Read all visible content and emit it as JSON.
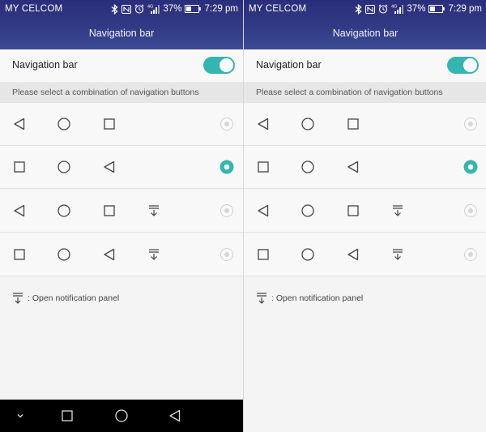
{
  "status_bar": {
    "carrier": "MY CELCOM",
    "battery": "37%",
    "time": "7:29 pm",
    "network_label": "4G",
    "icons": [
      "bluetooth-icon",
      "nfc-icon",
      "alarm-icon",
      "signal-icon",
      "battery-icon"
    ]
  },
  "header": {
    "title": "Navigation bar"
  },
  "navigation_toggle": {
    "label": "Navigation bar",
    "enabled": true
  },
  "section": {
    "title": "Please select a combination of navigation buttons"
  },
  "options": [
    {
      "buttons": [
        "back",
        "home",
        "recent"
      ],
      "selected": false
    },
    {
      "buttons": [
        "recent",
        "home",
        "back"
      ],
      "selected": true
    },
    {
      "buttons": [
        "back",
        "home",
        "recent",
        "notification"
      ],
      "selected": false
    },
    {
      "buttons": [
        "recent",
        "home",
        "back",
        "notification"
      ],
      "selected": false
    }
  ],
  "footnote": {
    "icon": "notification-pull-icon",
    "text": ": Open notification panel"
  },
  "system_nav": {
    "buttons": [
      "hide",
      "recent",
      "home",
      "back"
    ]
  },
  "colors": {
    "accent": "#33b5b2",
    "header": "#313a85",
    "system_nav": "#000000"
  }
}
